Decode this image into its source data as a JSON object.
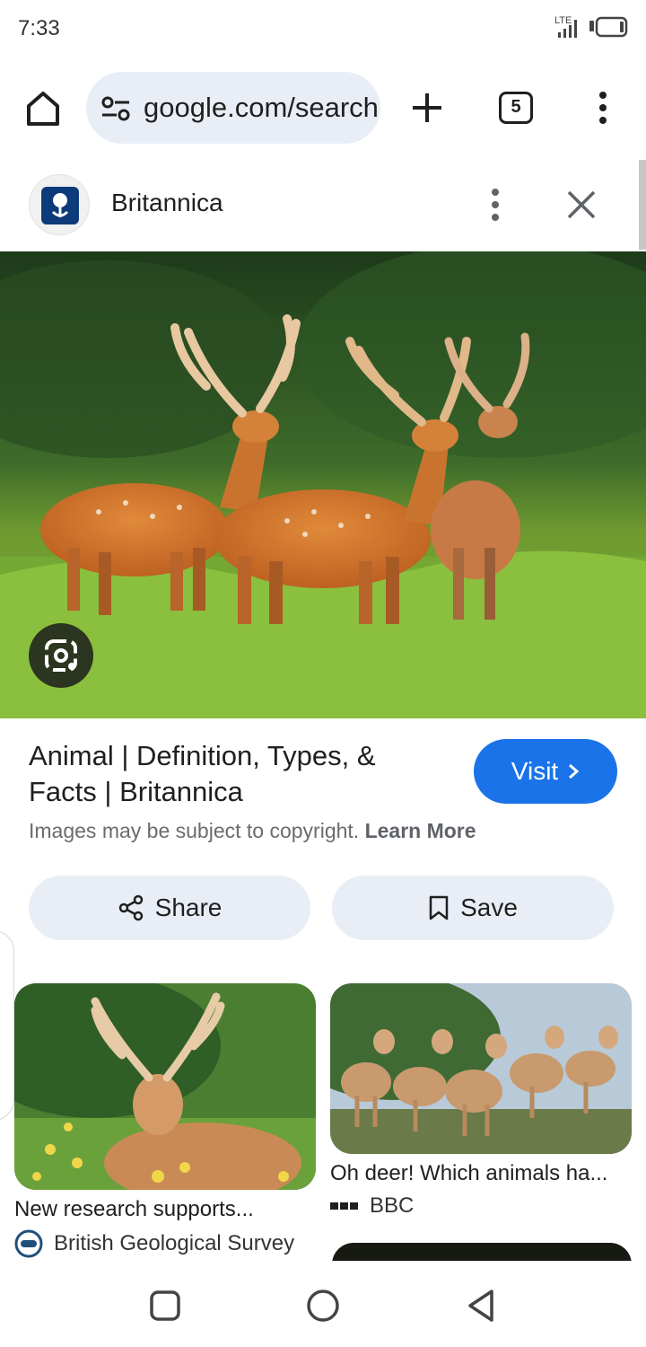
{
  "status_bar": {
    "time": "7:33",
    "network": "LTE",
    "icons": [
      "signal-icon",
      "battery-icon"
    ]
  },
  "browser": {
    "url": "google.com/search",
    "tab_count": "5",
    "icons": [
      "home-icon",
      "tune-icon",
      "plus-icon",
      "tab-switcher-icon",
      "more-vert-icon"
    ]
  },
  "panel": {
    "site_name": "Britannica",
    "icons": [
      "britannica-favicon",
      "more-vert-icon",
      "close-icon"
    ]
  },
  "result": {
    "title": "Animal | Definition, Types, & Facts | Britannica",
    "visit_label": "Visit",
    "copyright_text": "Images may be subject to copyright.",
    "learn_more": "Learn More",
    "share_label": "Share",
    "save_label": "Save"
  },
  "related": [
    {
      "title": "New research supports...",
      "source": "British Geological Survey"
    },
    {
      "title": "Oh deer! Which animals ha...",
      "source": "BBC"
    }
  ],
  "nav_bar": {
    "icons": [
      "recents-icon",
      "home-circle-icon",
      "back-icon"
    ]
  },
  "colors": {
    "accent": "#1a73e8",
    "pill_bg": "#e9eef6",
    "text": "#1f1f1f",
    "muted": "#6b6b6b"
  }
}
